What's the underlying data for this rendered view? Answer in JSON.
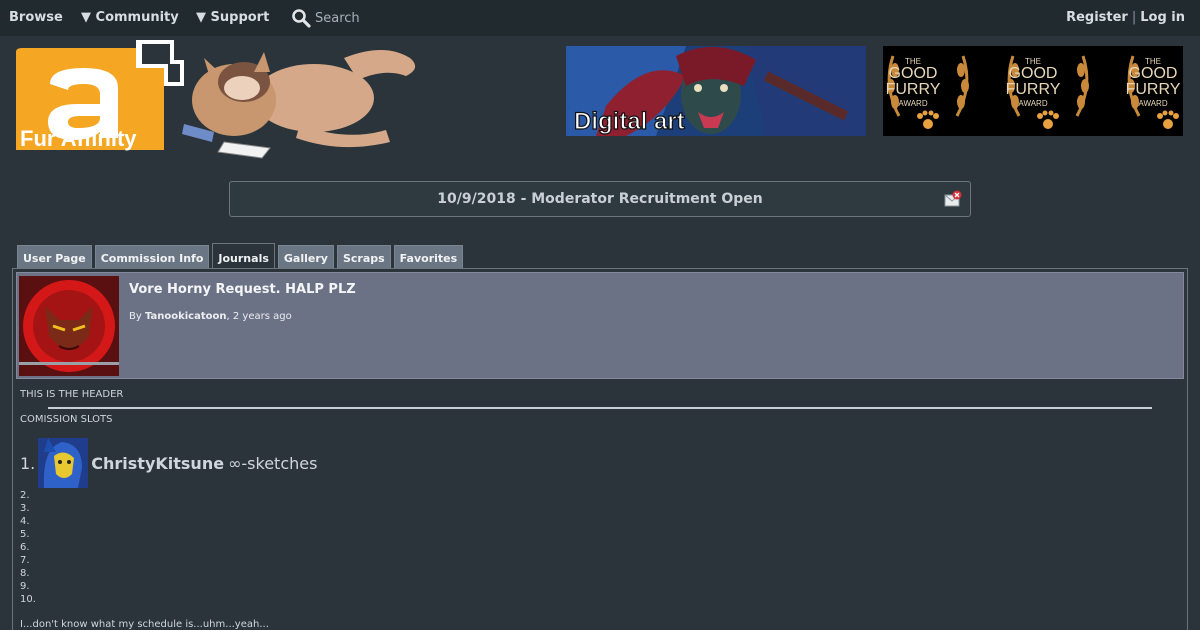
{
  "nav": {
    "browse": "Browse",
    "community": "▼ Community",
    "support": "▼ Support",
    "search": "Search",
    "register": "Register",
    "separator": "|",
    "login": "Log in"
  },
  "logo": {
    "text": "Fur Affinity"
  },
  "banners": {
    "digital_art": "Digital art",
    "award": [
      "THE",
      "GOOD",
      "FURRY",
      "AWARD"
    ]
  },
  "notice": {
    "text": "10/9/2018 - Moderator Recruitment Open"
  },
  "tabs": [
    {
      "label": "User Page",
      "active": false
    },
    {
      "label": "Commission Info",
      "active": false
    },
    {
      "label": "Journals",
      "active": true
    },
    {
      "label": "Gallery",
      "active": false
    },
    {
      "label": "Scraps",
      "active": false
    },
    {
      "label": "Favorites",
      "active": false
    }
  ],
  "journal": {
    "title": "Vore Horny Request. HALP PLZ",
    "by_prefix": "By ",
    "author": "Tanookicatoon",
    "time": ", 2 years ago"
  },
  "body": {
    "header_text": "THIS IS THE HEADER",
    "commission_label": "COMISSION SLOTS",
    "slot1_number": "1.",
    "slot1_name": "ChristyKitsune",
    "slot1_note": "∞-sketches",
    "other_slots": [
      "2.",
      "3.",
      "4.",
      "5.",
      "6.",
      "7.",
      "8.",
      "9.",
      "10."
    ],
    "footer": "I...don't know what my schedule is...uhm...yeah..."
  },
  "colors": {
    "nav_bg": "#212a2f",
    "page_bg": "#2a343a",
    "tab_bg": "#6b7684",
    "journal_head_bg": "#6c7286",
    "logo_orange": "#f5a623"
  }
}
